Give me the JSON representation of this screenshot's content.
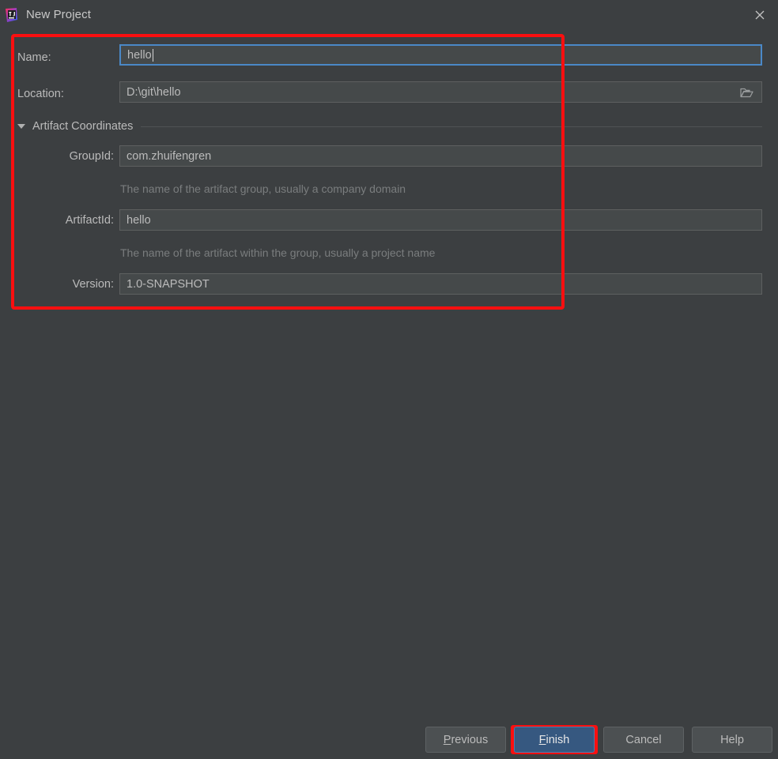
{
  "window": {
    "title": "New Project",
    "app_icon": "intellij-idea-icon",
    "close_icon": "close-icon",
    "background_color": "#3c3f41",
    "accent_color": "#365880",
    "annotation_color": "#fa0f10",
    "focus_border_color": "#4a88c7"
  },
  "form": {
    "name": {
      "label": "Name:",
      "value": "hello",
      "focused": true
    },
    "location": {
      "label": "Location:",
      "value": "D:\\git\\hello",
      "browse_icon": "folder-icon"
    },
    "section": {
      "label": "Artifact Coordinates",
      "expanded": true,
      "toggle_icon": "chevron-down-icon"
    },
    "group_id": {
      "label": "GroupId:",
      "value": "com.zhuifengren",
      "hint": "The name of the artifact group, usually a company domain"
    },
    "artifact_id": {
      "label": "ArtifactId:",
      "value": "hello",
      "hint": "The name of the artifact within the group, usually a project name"
    },
    "version": {
      "label": "Version:",
      "value": "1.0-SNAPSHOT"
    }
  },
  "buttons": {
    "previous": {
      "prefix": "P",
      "rest": "revious"
    },
    "finish": {
      "prefix": "F",
      "rest": "inish"
    },
    "cancel": {
      "label": "Cancel"
    },
    "help": {
      "label": "Help"
    }
  }
}
